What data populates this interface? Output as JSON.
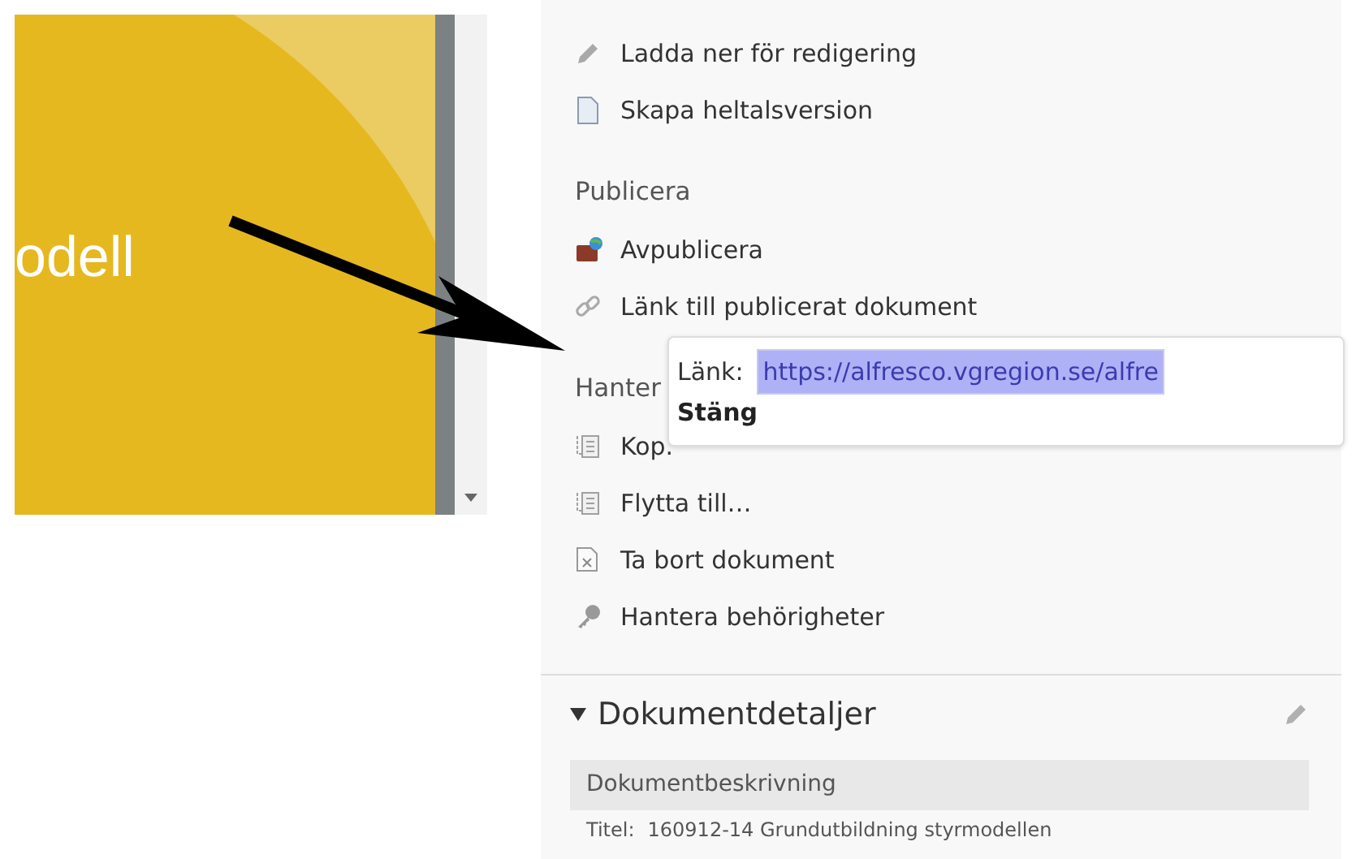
{
  "preview": {
    "slide_text": "odell"
  },
  "actions": {
    "groups": [
      {
        "items": [
          {
            "kind": "pencil",
            "label": "Ladda ner för redigering"
          },
          {
            "kind": "document",
            "label": "Skapa heltalsversion"
          }
        ]
      },
      {
        "heading": "Publicera",
        "items": [
          {
            "kind": "unpublish",
            "label": "Avpublicera"
          },
          {
            "kind": "link",
            "label": "Länk till publicerat dokument"
          }
        ]
      },
      {
        "heading": "Hanter",
        "items": [
          {
            "kind": "copy",
            "label": "Kop."
          },
          {
            "kind": "copy",
            "label": "Flytta till…"
          },
          {
            "kind": "delete",
            "label": "Ta bort dokument"
          },
          {
            "kind": "key",
            "label": "Hantera behörigheter"
          }
        ]
      }
    ]
  },
  "link_popup": {
    "label": "Länk:",
    "value": "https://alfresco.vgregion.se/alfre",
    "value_selected": true,
    "close": "Stäng"
  },
  "details": {
    "title": "Dokumentdetaljer",
    "expanded": true,
    "subheading": "Dokumentbeskrivning",
    "fields": [
      {
        "label": "Titel:",
        "value": "160912-14 Grundutbildning styrmodellen"
      }
    ]
  }
}
